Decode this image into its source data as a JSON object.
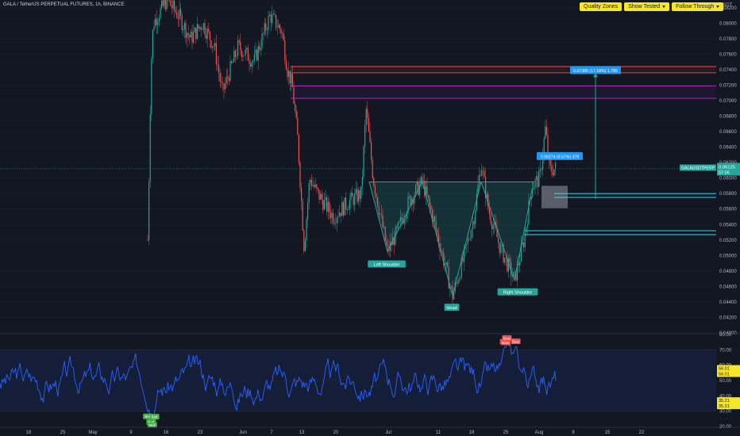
{
  "header": {
    "title": "GALA / TetherUS PERPETUAL FUTURES, 1h, BINANCE",
    "currency": "USDT"
  },
  "toolbar": {
    "quality_zones": "Quality Zones",
    "show_tested": "Show Tested",
    "follow_through": "Follow Through"
  },
  "price_axis": {
    "ticks": [
      "0.08200",
      "0.08000",
      "0.07800",
      "0.07600",
      "0.07400",
      "0.07200",
      "0.07000",
      "0.06800",
      "0.06600",
      "0.06400",
      "0.06200",
      "0.06000",
      "0.05800",
      "0.05600",
      "0.05400",
      "0.05200",
      "0.05000",
      "0.04800",
      "0.04600",
      "0.04400",
      "0.04200",
      "0.04000"
    ],
    "tag_symbol": "GALAUSDTPERP",
    "tag_price": "0.06125",
    "tag_time": "57:05"
  },
  "rsi_axis": {
    "ticks": [
      "80.00",
      "70.00",
      "60.00",
      "50.00",
      "40.00",
      "30.00",
      "20.00"
    ],
    "last1": "56.01",
    "last2": "56.01",
    "lower1": "35.21",
    "lower2": "35.21"
  },
  "time_axis": [
    "18",
    "25",
    "May",
    "9",
    "16",
    "23",
    "Jun",
    "7",
    "13",
    "20",
    "Jul",
    "11",
    "18",
    "25",
    "Aug",
    "8",
    "15",
    "22"
  ],
  "pattern_labels": {
    "left": "Left Shoulder",
    "head": "Head",
    "right": "Right Shoulder"
  },
  "target_label": "0.07385 (17.18%) 1,789",
  "entry_label": "0.06274 (0.57%) 379",
  "rsi_tags": {
    "bull": "Bull",
    "bear": "Bear"
  },
  "colors": {
    "bg": "#131722",
    "candle_up": "#26a69a",
    "candle_down": "#ef5350",
    "rsi": "#2962ff",
    "zone_green": "#26c6da",
    "zone_red": "#e53935",
    "zone_purple": "#9c27b0"
  },
  "chart_data": [
    {
      "type": "candlestick",
      "title": "GALA / TetherUS PERPETUAL FUTURES, 1h, BINANCE",
      "ylim": [
        0.04,
        0.083
      ],
      "pattern": "inverse head and shoulders",
      "pattern_points": [
        {
          "label": "Left Shoulder",
          "price": 0.0505
        },
        {
          "label": "Head",
          "price": 0.0448
        },
        {
          "label": "Right Shoulder",
          "price": 0.0468
        }
      ],
      "neckline": 0.0595,
      "levels": [
        {
          "color": "red",
          "price": 0.0744
        },
        {
          "color": "red",
          "price": 0.0736
        },
        {
          "color": "purple",
          "price": 0.0719
        },
        {
          "color": "purple",
          "price": 0.0703
        },
        {
          "color": "teal",
          "price": 0.058
        },
        {
          "color": "teal",
          "price": 0.0575
        },
        {
          "color": "teal",
          "price": 0.0532
        },
        {
          "color": "teal",
          "price": 0.0527
        }
      ],
      "target": 0.07385,
      "entry": 0.06274,
      "last_price": 0.06125
    },
    {
      "type": "line",
      "name": "RSI",
      "ylim": [
        20,
        80
      ],
      "band": [
        30,
        70
      ],
      "last_value": 56.01
    }
  ]
}
